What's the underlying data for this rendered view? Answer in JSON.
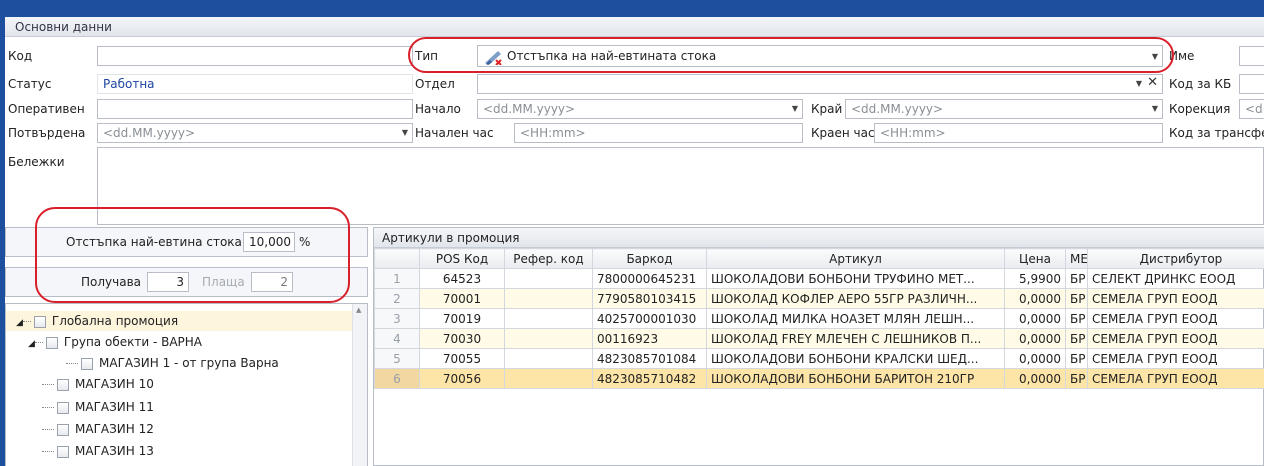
{
  "header": {
    "group_title": "Основни данни"
  },
  "form": {
    "code_label": "Код",
    "status_label": "Статус",
    "status_value": "Работна",
    "operative_label": "Оперативен",
    "confirmed_label": "Потвърдена",
    "confirmed_placeholder": "<dd.MM.yyyy>",
    "notes_label": "Бележки",
    "type_label": "Тип",
    "type_value": "Отстъпка на най-евтината стока",
    "department_label": "Отдел",
    "start_label": "Начало",
    "start_placeholder": "<dd.MM.yyyy>",
    "end_label": "Край",
    "end_placeholder": "<dd.MM.yyyy>",
    "start_time_label": "Начален час",
    "start_time_placeholder": "<HH:mm>",
    "end_time_label": "Краен час",
    "end_time_placeholder": "<HH:mm>",
    "name_label": "Име",
    "kb_code_label": "Код за КБ",
    "correction_label": "Корекция",
    "correction_placeholder": "<d",
    "transfer_code_label": "Код за трансфе"
  },
  "discount": {
    "label": "Отстъпка най-евтина стока",
    "value": "10,000",
    "unit": "%",
    "receives_label": "Получава",
    "receives_value": "3",
    "pays_label": "Плаща",
    "pays_value": "2"
  },
  "tree": {
    "items": [
      {
        "label": "Глобална промоция"
      },
      {
        "label": "Група обекти - ВАРНА"
      },
      {
        "label": "МАГАЗИН 1 - от група Варна"
      },
      {
        "label": "МАГАЗИН 10"
      },
      {
        "label": "МАГАЗИН 11"
      },
      {
        "label": "МАГАЗИН 12"
      },
      {
        "label": "МАГАЗИН 13"
      }
    ]
  },
  "articles": {
    "title": "Артикули в промоция",
    "columns": [
      "POS Код",
      "Рефер. код",
      "Баркод",
      "Артикул",
      "Цена",
      "МЕ",
      "Дистрибутор"
    ],
    "rows": [
      {
        "n": "1",
        "pos": "64523",
        "ref": "",
        "barcode": "7800000645231",
        "article": "ШОКОЛАДОВИ БОНБОНИ ТРУФИНО МЕТ...",
        "price": "5,9900",
        "unit": "БР",
        "dist": "СЕЛЕКТ ДРИНКС ЕООД"
      },
      {
        "n": "2",
        "pos": "70001",
        "ref": "",
        "barcode": "7790580103415",
        "article": "ШОКОЛАД КОФЛЕР АЕРО 55ГР РАЗЛИЧН...",
        "price": "0,0000",
        "unit": "БР",
        "dist": "СЕМЕЛА ГРУП ЕООД"
      },
      {
        "n": "3",
        "pos": "70019",
        "ref": "",
        "barcode": "4025700001030",
        "article": "ШОКОЛАД МИЛКА НОАЗЕТ МЛЯН ЛЕШН...",
        "price": "0,0000",
        "unit": "БР",
        "dist": "СЕМЕЛА ГРУП ЕООД"
      },
      {
        "n": "4",
        "pos": "70030",
        "ref": "",
        "barcode": "00116923",
        "article": "ШОКОЛАД FREY МЛЕЧЕН С ЛЕШНИКОВ П...",
        "price": "0,0000",
        "unit": "БР",
        "dist": "СЕМЕЛА ГРУП ЕООД"
      },
      {
        "n": "5",
        "pos": "70055",
        "ref": "",
        "barcode": "4823085701084",
        "article": "ШОКОЛАДОВИ БОНБОНИ КРАЛСКИ ШЕД...",
        "price": "0,0000",
        "unit": "БР",
        "dist": "СЕМЕЛА ГРУП ЕООД"
      },
      {
        "n": "6",
        "pos": "70056",
        "ref": "",
        "barcode": "4823085710482",
        "article": "ШОКОЛАДОВИ БОНБОНИ БАРИТОН 210ГР",
        "price": "0,0000",
        "unit": "БР",
        "dist": "СЕМЕЛА ГРУП ЕООД"
      }
    ]
  },
  "colors": {
    "frame": "#1d4f9f",
    "highlight": "#d9202a",
    "selected_row": "#fde4a7"
  }
}
